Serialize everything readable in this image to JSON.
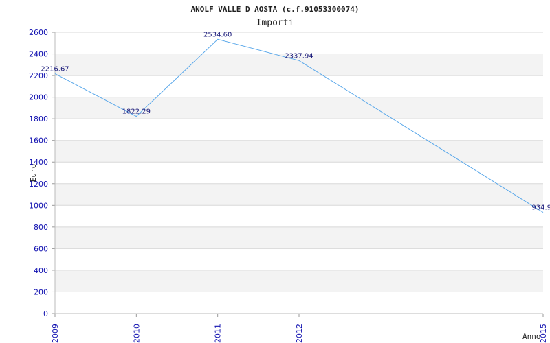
{
  "chart_data": {
    "type": "line",
    "title": "ANOLF VALLE D AOSTA (c.f.91053300074)",
    "subtitle": "Importi",
    "xlabel": "Anno",
    "ylabel": "Euro",
    "x": [
      "2009",
      "2010",
      "2011",
      "2012",
      "2015"
    ],
    "series": [
      {
        "values": [
          2216.67,
          1822.29,
          2534.6,
          2337.94,
          934.9
        ],
        "labels": [
          "2216.67",
          "1822.29",
          "2534.60",
          "2337.94",
          "934.9"
        ]
      }
    ],
    "ylim": [
      0,
      2600
    ],
    "yticks": [
      "0",
      "200",
      "400",
      "600",
      "800",
      "1000",
      "1200",
      "1400",
      "1600",
      "1800",
      "2000",
      "2200",
      "2400",
      "2600"
    ],
    "grid": "horizontal alternating bands",
    "colors": {
      "line": "#5aa8ea",
      "band": "#f3f3f3",
      "gridline": "#d8d8d8",
      "tick_text": "#1010b0",
      "data_label": "#1a1a7a"
    }
  }
}
